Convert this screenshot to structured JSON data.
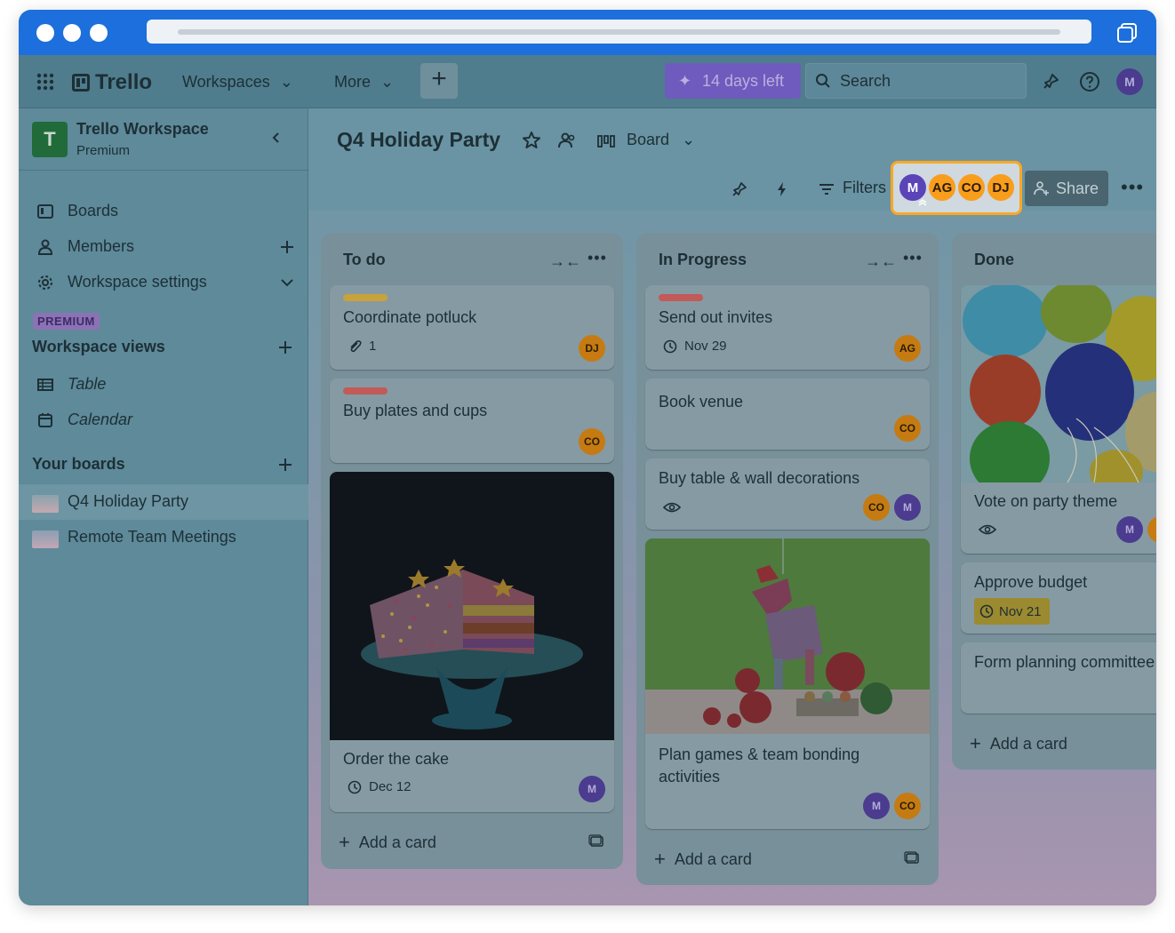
{
  "colors": {
    "browser_chrome": "#1c6fdc",
    "highlight_border": "#f9a824",
    "trial_button": "#6f5bbd",
    "label_yellow": "#c8a23a",
    "label_red": "#c25a58",
    "workspace_logo": "#216b3a"
  },
  "topnav": {
    "brand": "Trello",
    "workspaces_label": "Workspaces",
    "more_label": "More",
    "create_label": "+",
    "trial_label": "14 days left",
    "search_placeholder": "Search",
    "user_initial": "M"
  },
  "sidebar": {
    "workspace_name": "Trello Workspace",
    "workspace_plan": "Premium",
    "workspace_initial": "T",
    "items": [
      {
        "label": "Boards",
        "icon": "board-icon"
      },
      {
        "label": "Members",
        "icon": "member-icon"
      },
      {
        "label": "Workspace settings",
        "icon": "gear-icon"
      }
    ],
    "premium_badge": "PREMIUM",
    "views_heading": "Workspace views",
    "views": [
      {
        "label": "Table",
        "icon": "table-icon"
      },
      {
        "label": "Calendar",
        "icon": "calendar-icon"
      }
    ],
    "boards_heading": "Your boards",
    "boards": [
      {
        "label": "Q4 Holiday Party",
        "active": true
      },
      {
        "label": "Remote Team Meetings",
        "active": false
      }
    ]
  },
  "board": {
    "title": "Q4 Holiday Party",
    "view_label": "Board",
    "filters_label": "Filters",
    "share_label": "Share",
    "members": [
      "M",
      "AG",
      "CO",
      "DJ"
    ],
    "lists": [
      {
        "title": "To do",
        "add_label": "Add a card",
        "cards": [
          {
            "title": "Coordinate potluck",
            "label_color": "#c8a23a",
            "attachments": "1",
            "members": [
              "DJ"
            ]
          },
          {
            "title": "Buy plates and cups",
            "label_color": "#c25a58",
            "members": [
              "CO"
            ]
          },
          {
            "title": "Order the cake",
            "cover": "cake",
            "due": "Dec 12",
            "members": [
              "M"
            ]
          }
        ]
      },
      {
        "title": "In Progress",
        "add_label": "Add a card",
        "cards": [
          {
            "title": "Send out invites",
            "label_color": "#c25a58",
            "due": "Nov 29",
            "members": [
              "AG"
            ]
          },
          {
            "title": "Book venue",
            "members": [
              "CO"
            ]
          },
          {
            "title": "Buy table & wall decorations",
            "watching": true,
            "members": [
              "CO",
              "M"
            ]
          },
          {
            "title": "Plan games & team bonding activities",
            "cover": "pinata",
            "members": [
              "M",
              "CO"
            ]
          }
        ]
      },
      {
        "title": "Done",
        "add_label": "Add a card",
        "cards": [
          {
            "title": "Vote on party theme",
            "cover": "balloons",
            "watching": true,
            "members": [
              "M"
            ]
          },
          {
            "title": "Approve budget",
            "due": "Nov 21"
          },
          {
            "title": "Form planning committee"
          }
        ]
      }
    ]
  }
}
